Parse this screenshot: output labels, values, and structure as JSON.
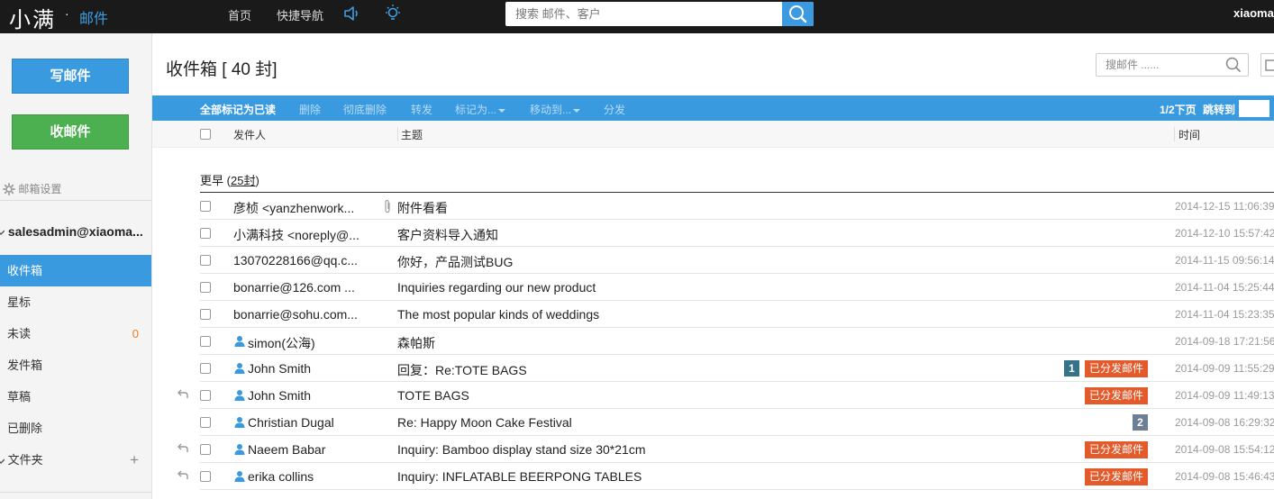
{
  "topbar": {
    "logo_main": "小满",
    "logo_dot": "·",
    "logo_sub": "邮件",
    "nav": [
      "首页",
      "快捷导航"
    ],
    "search_placeholder": "搜索 邮件、客户",
    "user": "xiaoman"
  },
  "sidebar": {
    "write_label": "写邮件",
    "receive_label": "收邮件",
    "settings_label": "邮箱设置",
    "account": "salesadmin@xiaoma...",
    "folders": {
      "inbox": "收件箱",
      "starred": "星标",
      "unread": "未读",
      "unread_count": "0",
      "sent": "发件箱",
      "drafts": "草稿",
      "deleted": "已删除",
      "folders": "文件夹",
      "add": "+"
    }
  },
  "main": {
    "title": "收件箱",
    "title_count": "[ 40 封]",
    "search_placeholder": "搜邮件 ......",
    "toolbar": {
      "mark_all_read": "全部标记为已读",
      "delete": "删除",
      "delete_forever": "彻底删除",
      "forward": "转发",
      "mark_as": "标记为...",
      "move_to": "移动到...",
      "distribute": "分发",
      "page_info": "1/2下页",
      "jump_to": "跳转到"
    },
    "columns": {
      "sender": "发件人",
      "subject": "主题",
      "time": "时间"
    },
    "group": {
      "label": "更早",
      "paren_open": "(",
      "count": "25封",
      "paren_close": ")"
    },
    "distributed_label": "已分发邮件",
    "emails": [
      {
        "sender": "彦桢 <yanzhenwork...",
        "subject": "附件看看",
        "time": "2014-12-15 11:06:39"
      },
      {
        "sender": "小满科技 <noreply@...",
        "subject": "客户资料导入通知",
        "time": "2014-12-10 15:57:42"
      },
      {
        "sender": "13070228166@qq.c...",
        "subject": "你好，产品测试BUG",
        "time": "2014-11-15 09:56:14"
      },
      {
        "sender": "bonarrie@126.com ...",
        "subject": "Inquiries regarding our new product",
        "time": "2014-11-04 15:25:44"
      },
      {
        "sender": "bonarrie@sohu.com...",
        "subject": "The most popular kinds of weddings",
        "time": "2014-11-04 15:23:35"
      },
      {
        "sender": "simon(公海)",
        "subject": "森帕斯",
        "time": "2014-09-18 17:21:56"
      },
      {
        "sender": "John Smith",
        "subject": "回复：Re:TOTE BAGS",
        "time": "2014-09-09 11:55:29",
        "thread": "1"
      },
      {
        "sender": "John Smith",
        "subject": "TOTE BAGS",
        "time": "2014-09-09 11:49:13"
      },
      {
        "sender": "Christian Dugal",
        "subject": "Re: Happy Moon Cake Festival",
        "time": "2014-09-08 16:29:32",
        "thread": "2"
      },
      {
        "sender": "Naeem Babar",
        "subject": "Inquiry: Bamboo display stand size 30*21cm",
        "time": "2014-09-08 15:54:12"
      },
      {
        "sender": "erika collins",
        "subject": "Inquiry: INFLATABLE BEERPONG TABLES",
        "time": "2014-09-08 15:46:43"
      }
    ]
  },
  "colors": {
    "accent": "#3a9ae0",
    "topbar": "#1a1a1a",
    "receive_button": "#4caf50",
    "distributed_badge": "#e45a2a",
    "unread_count": "#f07b1c"
  },
  "icons": {
    "search": "search-icon",
    "speaker": "speaker-icon",
    "bulb": "lightbulb-icon",
    "gear": "gear-icon",
    "person": "person-icon",
    "reply": "reply-icon",
    "attachment": "paperclip-icon"
  }
}
